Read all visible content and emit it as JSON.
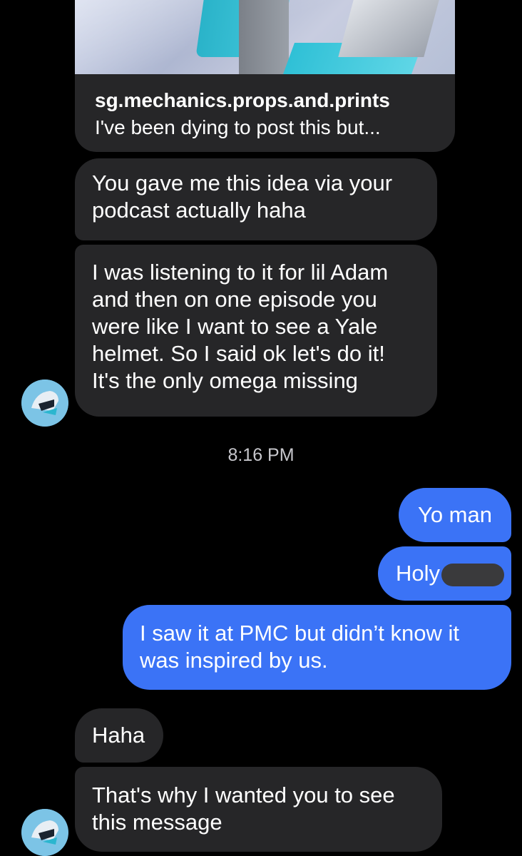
{
  "shared_post": {
    "handle": "sg.mechanics.props.and.prints",
    "caption": "I've been dying to post this but..."
  },
  "messages": [
    {
      "direction": "incoming",
      "text": "You gave me this idea via your\npodcast actually haha"
    },
    {
      "direction": "incoming",
      "text": "I was listening to it for lil Adam\nand then on one episode you\nwere like I want to see a Yale\nhelmet. So I said ok let's do it!\nIt's the only omega missing"
    },
    {
      "direction": "outgoing",
      "text": "Yo man"
    },
    {
      "direction": "outgoing",
      "text": "Holy"
    },
    {
      "direction": "outgoing",
      "text": "I saw it at PMC but didn’t know it\nwas inspired by us."
    },
    {
      "direction": "incoming",
      "text": "Haha"
    },
    {
      "direction": "incoming",
      "text": "That's why I wanted you to see\nthis message"
    }
  ],
  "timestamp": "8:16 PM",
  "colors": {
    "background": "#000000",
    "incoming_bubble": "#262628",
    "outgoing_bubble": "#3b73f6",
    "timestamp_text": "#c7c7cc"
  },
  "icons": {
    "avatar": "avatar-icon",
    "redaction": "redacted-text"
  }
}
